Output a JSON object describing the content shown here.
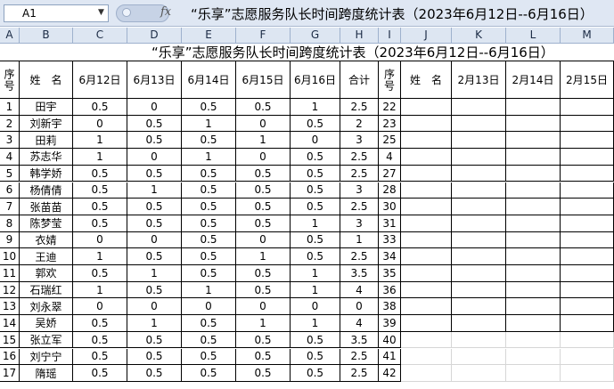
{
  "formula_bar": {
    "name_box": "A1",
    "fx_label": "fx",
    "formula": "“乐享”志愿服务队长时间跨度统计表（2023年6月12日--6月16日）"
  },
  "columns": [
    "A",
    "B",
    "C",
    "D",
    "E",
    "F",
    "G",
    "H",
    "I",
    "J",
    "K",
    "L",
    "M"
  ],
  "title": "“乐享”志愿服务队长时间跨度统计表（2023年6月12日--6月16日）",
  "header": {
    "seq": "序号",
    "name": "姓　名",
    "d1": "6月12日",
    "d2": "6月13日",
    "d3": "6月14日",
    "d4": "6月15日",
    "d5": "6月16日",
    "total": "合计",
    "seq2": "序号",
    "name2": "姓　名",
    "k": "2月13日",
    "l": "2月14日",
    "m": "2月15日"
  },
  "rows": [
    {
      "seq": "1",
      "name": "田宇",
      "v": [
        "0.5",
        "0",
        "0.5",
        "0.5",
        "1"
      ],
      "total": "2.5",
      "seq2": "22"
    },
    {
      "seq": "2",
      "name": "刘新宇",
      "v": [
        "0",
        "0.5",
        "1",
        "0",
        "0.5"
      ],
      "total": "2",
      "seq2": "23"
    },
    {
      "seq": "3",
      "name": "田莉",
      "v": [
        "1",
        "0.5",
        "0.5",
        "1",
        "0"
      ],
      "total": "3",
      "seq2": "25"
    },
    {
      "seq": "4",
      "name": "苏志华",
      "v": [
        "1",
        "0",
        "1",
        "0",
        "0.5"
      ],
      "total": "2.5",
      "seq2": "4"
    },
    {
      "seq": "5",
      "name": "韩学娇",
      "v": [
        "0.5",
        "0.5",
        "0.5",
        "0.5",
        "0.5"
      ],
      "total": "2.5",
      "seq2": "27"
    },
    {
      "seq": "6",
      "name": "杨倩倩",
      "v": [
        "0.5",
        "1",
        "0.5",
        "0.5",
        "0.5"
      ],
      "total": "3",
      "seq2": "28"
    },
    {
      "seq": "7",
      "name": "张苗苗",
      "v": [
        "0.5",
        "0.5",
        "0.5",
        "0.5",
        "0.5"
      ],
      "total": "2.5",
      "seq2": "30"
    },
    {
      "seq": "8",
      "name": "陈梦莹",
      "v": [
        "0.5",
        "0.5",
        "0.5",
        "0.5",
        "1"
      ],
      "total": "3",
      "seq2": "31"
    },
    {
      "seq": "9",
      "name": "衣婧",
      "v": [
        "0",
        "0",
        "0.5",
        "0",
        "0.5"
      ],
      "total": "1",
      "seq2": "33"
    },
    {
      "seq": "10",
      "name": "王迪",
      "v": [
        "1",
        "0.5",
        "0.5",
        "1",
        "0.5"
      ],
      "total": "2.5",
      "seq2": "34"
    },
    {
      "seq": "11",
      "name": "郭欢",
      "v": [
        "0.5",
        "1",
        "0.5",
        "0.5",
        "1"
      ],
      "total": "3.5",
      "seq2": "35"
    },
    {
      "seq": "12",
      "name": "石瑞红",
      "v": [
        "1",
        "0.5",
        "1",
        "0.5",
        "1"
      ],
      "total": "4",
      "seq2": "36"
    },
    {
      "seq": "13",
      "name": "刘永翠",
      "v": [
        "0",
        "0",
        "0",
        "0",
        "0"
      ],
      "total": "0",
      "seq2": "38"
    },
    {
      "seq": "14",
      "name": "吴娇",
      "v": [
        "0.5",
        "1",
        "0.5",
        "1",
        "1"
      ],
      "total": "4",
      "seq2": "39"
    },
    {
      "seq": "15",
      "name": "张立军",
      "v": [
        "0.5",
        "0.5",
        "0.5",
        "0.5",
        "0.5"
      ],
      "total": "3.5",
      "seq2": "40"
    },
    {
      "seq": "16",
      "name": "刘宁宁",
      "v": [
        "0.5",
        "0.5",
        "0.5",
        "0.5",
        "0.5"
      ],
      "total": "2.5",
      "seq2": "41"
    },
    {
      "seq": "17",
      "name": "隋瑶",
      "v": [
        "0.5",
        "0.5",
        "0.5",
        "0.5",
        "0.5"
      ],
      "total": "2.5",
      "seq2": "42"
    }
  ]
}
